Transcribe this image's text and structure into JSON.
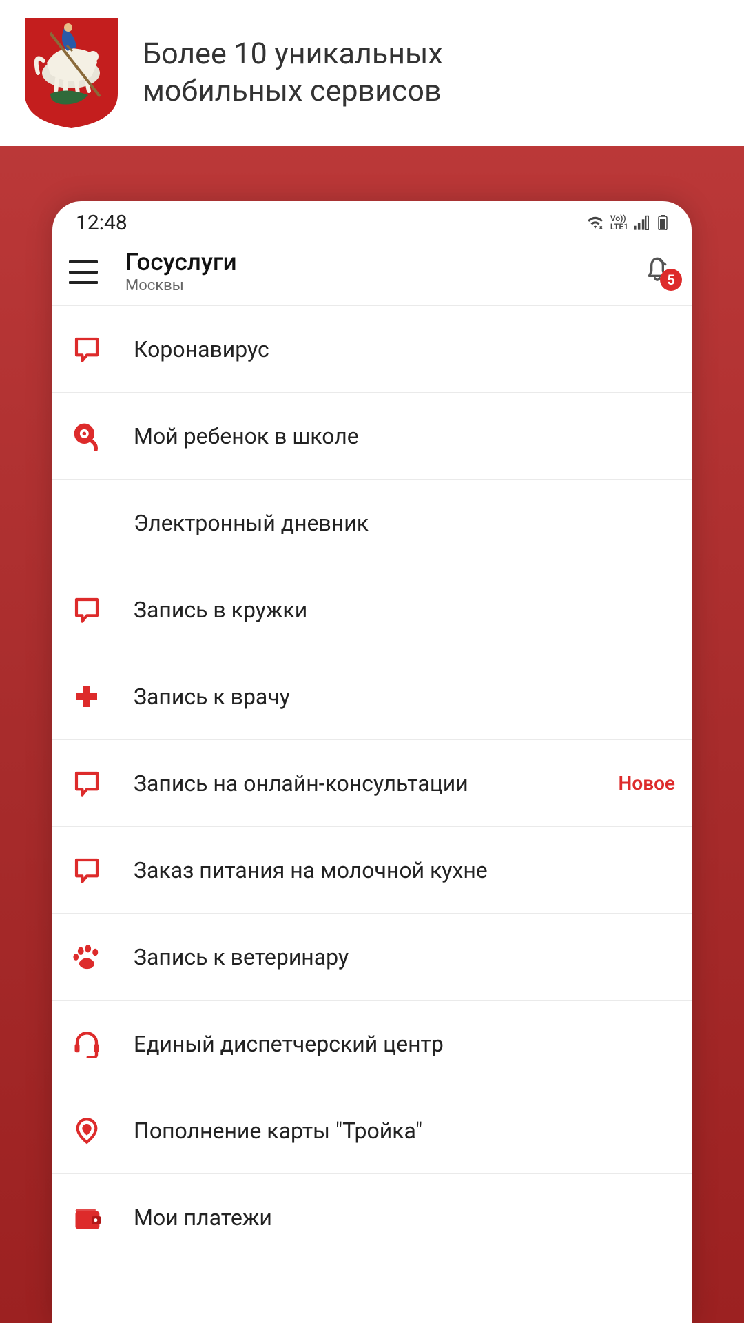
{
  "promo": {
    "tagline_line1": "Более 10 уникальных",
    "tagline_line2": "мобильных сервисов"
  },
  "status_bar": {
    "time": "12:48",
    "network_label": "LTE1",
    "voice_label": "Vo))"
  },
  "header": {
    "title": "Госуслуги",
    "subtitle": "Москвы",
    "notification_count": "5"
  },
  "services": [
    {
      "icon": "chat-bubble",
      "label": "Коронавирус",
      "badge": ""
    },
    {
      "icon": "alarm-bell",
      "label": "Мой ребенок в школе",
      "badge": ""
    },
    {
      "icon": "notebook",
      "label": "Электронный дневник",
      "badge": ""
    },
    {
      "icon": "chat-bubble",
      "label": "Запись в кружки",
      "badge": ""
    },
    {
      "icon": "medical-cross",
      "label": "Запись к врачу",
      "badge": ""
    },
    {
      "icon": "chat-bubble",
      "label": "Запись на онлайн-консультации",
      "badge": "Новое"
    },
    {
      "icon": "chat-bubble",
      "label": "Заказ питания на молочной кухне",
      "badge": ""
    },
    {
      "icon": "paw",
      "label": "Запись к ветеринару",
      "badge": ""
    },
    {
      "icon": "headset",
      "label": "Единый диспетчерский центр",
      "badge": ""
    },
    {
      "icon": "map-pin",
      "label": "Пополнение карты \"Тройка\"",
      "badge": ""
    },
    {
      "icon": "wallet",
      "label": "Мои платежи",
      "badge": ""
    }
  ]
}
